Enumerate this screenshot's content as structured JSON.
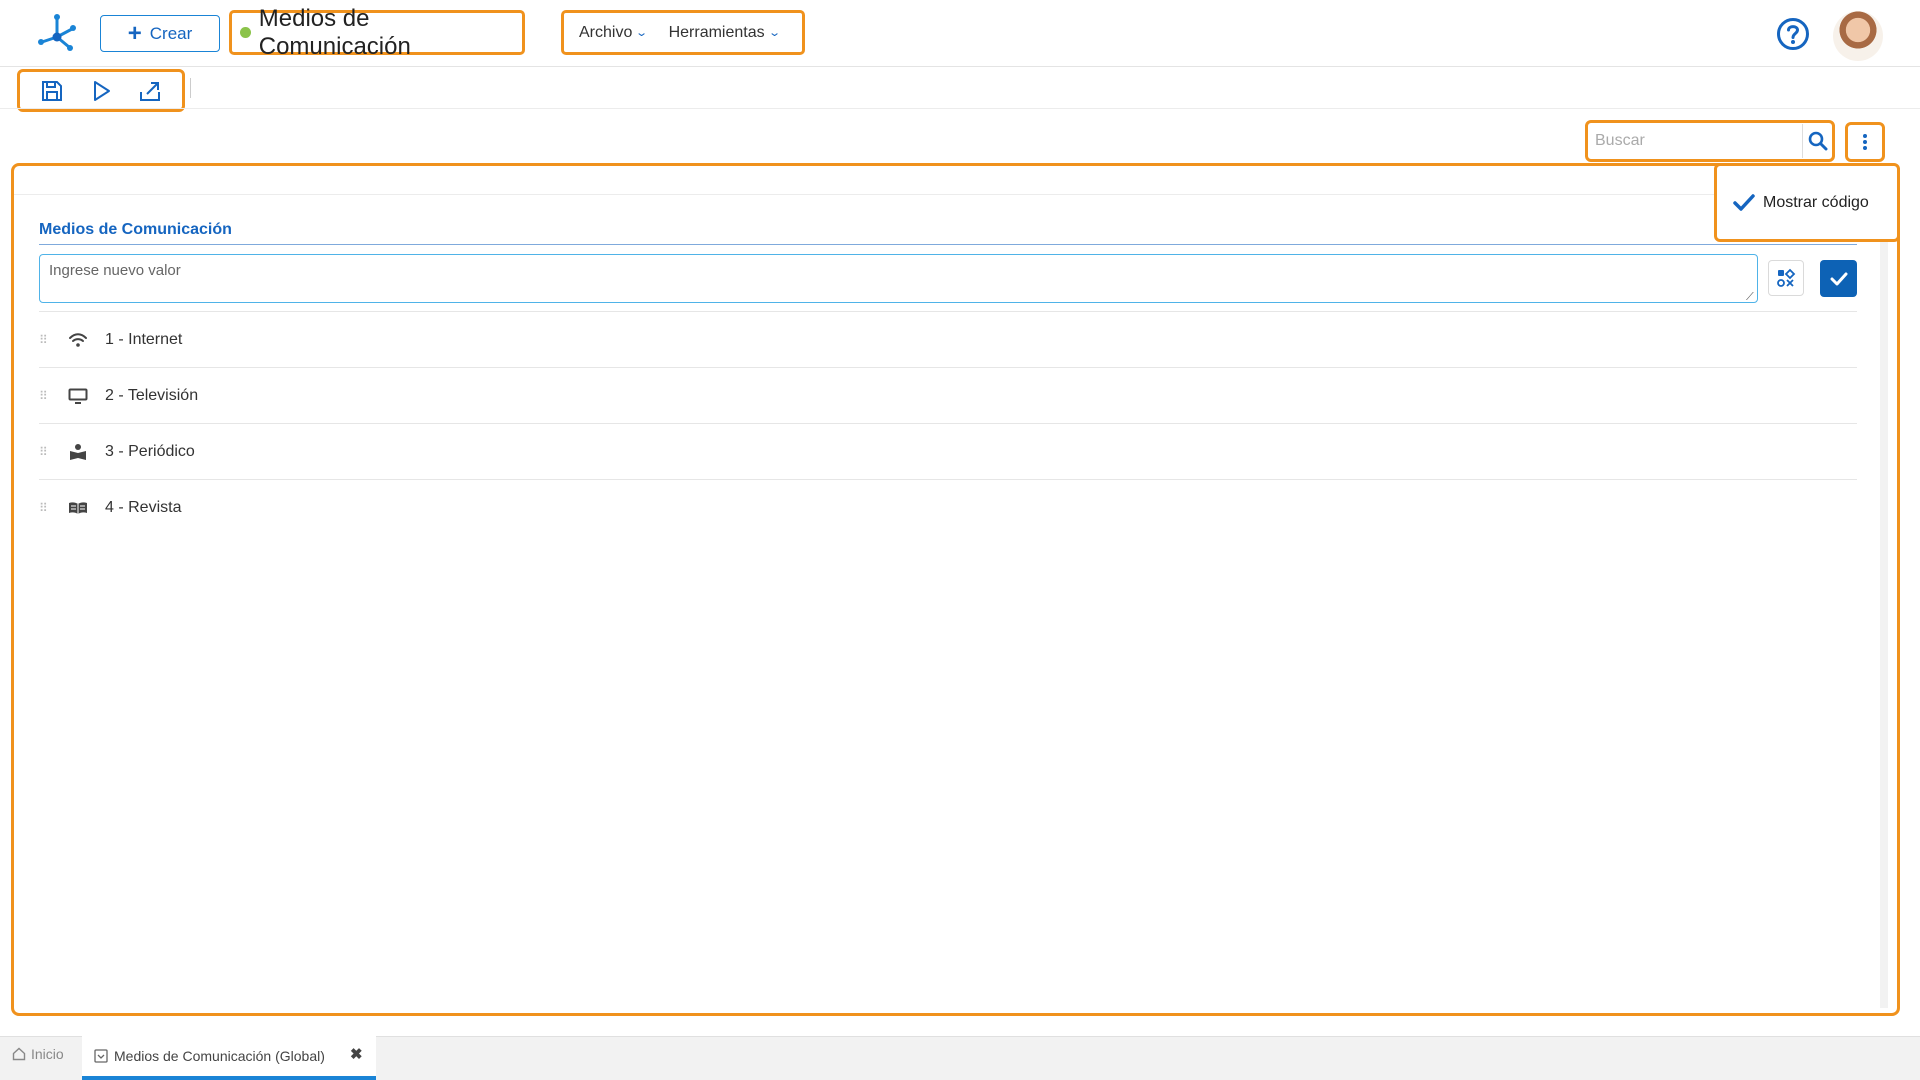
{
  "header": {
    "create_label": "Crear",
    "doc_title": "Medios de Comunicación",
    "menus": [
      "Archivo",
      "Herramientas"
    ],
    "icons": {
      "logo": "app-logo",
      "help": "question-circle-icon",
      "avatar": "user-avatar"
    }
  },
  "toolbar": {
    "icons": [
      "save-icon",
      "play-icon",
      "export-icon"
    ]
  },
  "search": {
    "placeholder": "Buscar"
  },
  "dropdown": {
    "mostrar_codigo_label": "Mostrar código",
    "checked": true
  },
  "main": {
    "section_title": "Medios de Comunicación",
    "new_value_placeholder": "Ingrese nuevo valor",
    "items": [
      {
        "label": "1 - Internet",
        "icon": "wifi-icon"
      },
      {
        "label": "2 - Televisión",
        "icon": "monitor-icon"
      },
      {
        "label": "3 - Periódico",
        "icon": "reader-icon"
      },
      {
        "label": "4 - Revista",
        "icon": "open-book-icon"
      }
    ]
  },
  "tabs": {
    "home_label": "Inicio",
    "active_label": "Medios de Comunicación (Global)"
  },
  "colors": {
    "accent": "#1565c0",
    "highlight": "#f0921d",
    "status": "#8bc34a"
  }
}
